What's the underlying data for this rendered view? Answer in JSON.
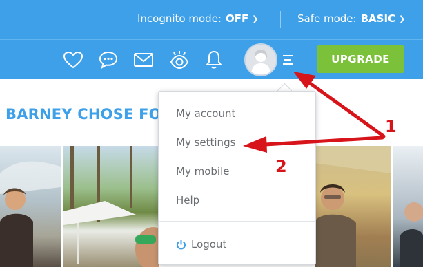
{
  "topbar": {
    "incognito_label": "Incognito mode:",
    "incognito_value": "OFF",
    "safe_label": "Safe mode:",
    "safe_value": "BASIC"
  },
  "navbar": {
    "icons": [
      "heart-icon",
      "chat-icon",
      "mail-icon",
      "eye-icon",
      "bell-icon"
    ],
    "upgrade_label": "UPGRADE"
  },
  "main": {
    "heading": "BARNEY CHOSE FO"
  },
  "menu": {
    "items": [
      {
        "label": "My account"
      },
      {
        "label": "My settings"
      },
      {
        "label": "My mobile"
      },
      {
        "label": "Help"
      }
    ],
    "logout_label": "Logout"
  },
  "annotations": {
    "step1": "1",
    "step2": "2",
    "color": "#d8141b"
  },
  "colors": {
    "brand_blue": "#3ea0e8",
    "upgrade_green": "#7bc13a",
    "menu_text": "#6a6e73"
  }
}
